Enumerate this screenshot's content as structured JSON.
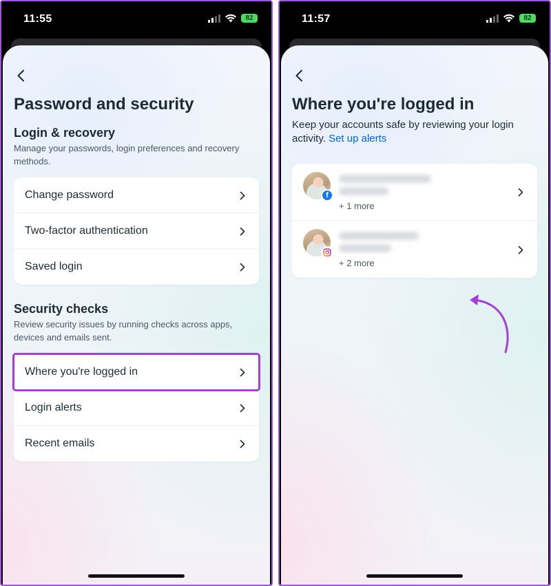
{
  "left": {
    "status": {
      "time": "11:55",
      "battery": "82"
    },
    "title": "Password and security",
    "login_recovery": {
      "title": "Login & recovery",
      "desc": "Manage your passwords, login preferences and recovery methods.",
      "items": [
        {
          "label": "Change password"
        },
        {
          "label": "Two-factor authentication"
        },
        {
          "label": "Saved login"
        }
      ]
    },
    "security_checks": {
      "title": "Security checks",
      "desc": "Review security issues by running checks across apps, devices and emails sent.",
      "items": [
        {
          "label": "Where you're logged in",
          "highlighted": true
        },
        {
          "label": "Login alerts"
        },
        {
          "label": "Recent emails"
        }
      ]
    }
  },
  "right": {
    "status": {
      "time": "11:57",
      "battery": "82"
    },
    "title": "Where you're logged in",
    "intro": "Keep your accounts safe by reviewing your login activity.",
    "intro_link": "Set up alerts",
    "accounts": [
      {
        "app_icon": "facebook-icon",
        "more": "+ 1 more"
      },
      {
        "app_icon": "instagram-icon",
        "more": "+ 2 more"
      }
    ]
  },
  "colors": {
    "highlight": "#a33fd6",
    "link": "#0064e0",
    "text": "#1c2b33",
    "battery": "#4cd964"
  }
}
